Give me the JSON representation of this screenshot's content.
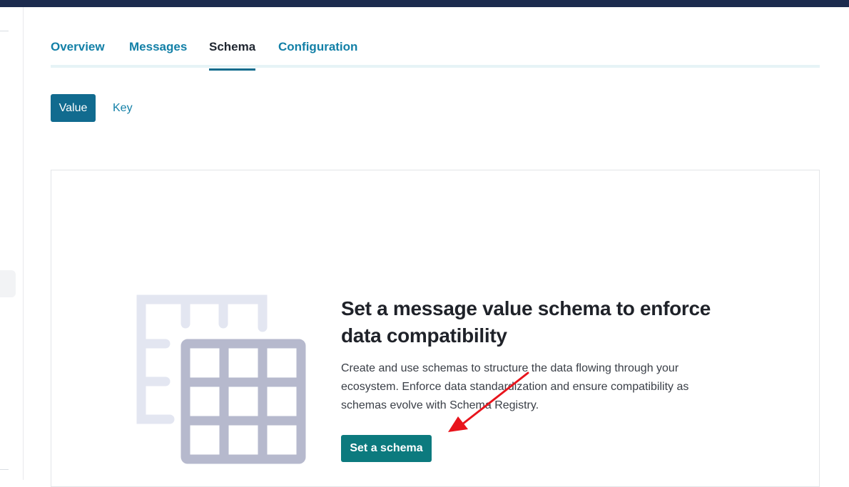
{
  "tabs": [
    {
      "label": "Overview",
      "active": false
    },
    {
      "label": "Messages",
      "active": false
    },
    {
      "label": "Schema",
      "active": true
    },
    {
      "label": "Configuration",
      "active": false
    }
  ],
  "segment": {
    "value_label": "Value",
    "key_label": "Key",
    "selected": "Value"
  },
  "empty_state": {
    "icon": "table-grid-icon",
    "title": "Set a message value schema to enforce data compatibility",
    "description": "Create and use schemas to structure the data flowing through your ecosystem. Enforce data standardization and ensure compatibility as schemas evolve with Schema Registry.",
    "cta_label": "Set a schema"
  },
  "annotation": {
    "icon": "red-arrow-icon",
    "color": "#e8141c"
  },
  "colors": {
    "topbar": "#1c2b4e",
    "tab_link": "#1380a7",
    "primary": "#116b8f",
    "cta": "#0c7a7e"
  }
}
